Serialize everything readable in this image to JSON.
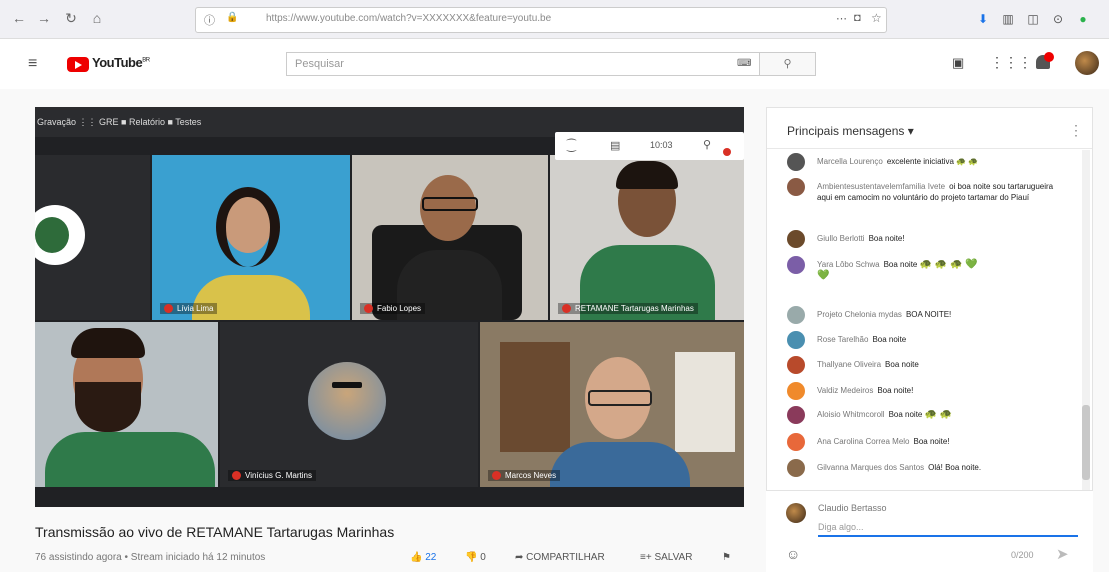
{
  "browser": {
    "url": "https://www.youtube.com/watch?v=XXXXXXX&feature=youtu.be",
    "icons": [
      "back-icon",
      "forward-icon",
      "reload-icon",
      "home-icon",
      "more-icon",
      "pocket-icon",
      "star-icon",
      "download-icon",
      "library-icon",
      "sidebar-icon",
      "account-icon",
      "extension-icon"
    ]
  },
  "youtube": {
    "logo_text": "YouTube",
    "logo_sup": "BR",
    "search_placeholder": "Pesquisar"
  },
  "video": {
    "meet_bar_text": "Gravação  ⋮⋮ GRE  ■ Relatório  ■ Testes",
    "toolbar_time": "10:03",
    "participants": [
      {
        "name": "",
        "label": "Lívia Lima"
      },
      {
        "name": "",
        "label": "Fabio Lopes"
      },
      {
        "name": "",
        "label": "RETAMANE Tartarugas Marinhas"
      },
      {
        "name": "",
        "label": ""
      },
      {
        "name": "",
        "label": "Vinícius G. Martins"
      },
      {
        "name": "",
        "label": "Marcos Neves"
      }
    ],
    "title": "Transmissão ao vivo de RETAMANE Tartarugas Marinhas",
    "meta": "76 assistindo agora • Stream iniciado há 12 minutos",
    "likes": "22",
    "dislikes": "0",
    "share": "COMPARTILHAR",
    "save": "SALVAR"
  },
  "chat": {
    "title": "Principais mensagens",
    "messages": [
      {
        "author": "Marcella Lourenço",
        "text": "excelente iniciativa",
        "color": "#555"
      },
      {
        "author": "Ambientesustentavelemfamilia Ivete",
        "text": "oi boa noite sou tartarugueira aqui em camocim no voluntário do projeto tartamar do Piauí",
        "color": "#8a5a44"
      },
      {
        "author": "Giullo Berlotti",
        "text": "Boa noite!",
        "color": "#6b4a2b"
      },
      {
        "author": "Yara Lôbo Schwa",
        "text": "Boa noite",
        "color": "#7b5ea7"
      },
      {
        "author": "Projeto Chelonia mydas",
        "text": "BOA NOITE!",
        "color": "#9aa"
      },
      {
        "author": "Rose Tarelhão",
        "text": "Boa noite",
        "color": "#4a8fb0"
      },
      {
        "author": "Thallyane Oliveira",
        "text": "Boa noite",
        "color": "#b84a2b"
      },
      {
        "author": "Valdiz Medeiros",
        "text": "Boa noite!",
        "color": "#f08a2b"
      },
      {
        "author": "Aloisio Whitmcoroll",
        "text": "Boa noite",
        "color": "#8a3a5b"
      },
      {
        "author": "Ana Carolina Correa Melo",
        "text": "Boa noite!",
        "color": "#e8683a"
      },
      {
        "author": "Gilvanna Marques dos Santos",
        "text": "Olá! Boa noite.",
        "color": "#8a6a4b"
      }
    ],
    "input_user": "Claudio Bertasso",
    "input_placeholder": "Diga algo...",
    "counter": "0/200"
  }
}
